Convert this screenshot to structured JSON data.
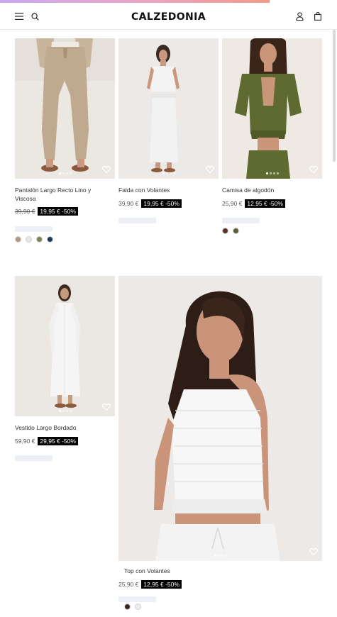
{
  "header": {
    "brand": "CALZEDONIA",
    "icons": [
      "menu-icon",
      "search-icon",
      "account-icon",
      "bag-icon"
    ]
  },
  "products": [
    {
      "name": "Pantalón Largo Recto Lino y Viscosa",
      "old_price": "39,90 €",
      "sale_label": "19,95 € -50%",
      "swatches": [
        "#b09a82",
        "#e6e6e6",
        "#7a8456",
        "#1e3a5a"
      ]
    },
    {
      "name": "Falda con Volantes",
      "old_price": "39,90 €",
      "sale_label": "19,95 € -50%",
      "swatches": []
    },
    {
      "name": "Camisa de algodón",
      "old_price": "25,90 €",
      "sale_label": "12,95 € -50%",
      "swatches": [
        "#5a3326",
        "#5b6132"
      ]
    },
    {
      "name": "Vestido Largo Bordado",
      "old_price": "59,90 €",
      "sale_label": "29,95 € -50%",
      "swatches": []
    },
    {
      "name": "Top con Volantes",
      "old_price": "25,90 €",
      "sale_label": "12,95 € -50%",
      "swatches": [
        "#3a2620",
        "#eeeeee"
      ]
    }
  ]
}
